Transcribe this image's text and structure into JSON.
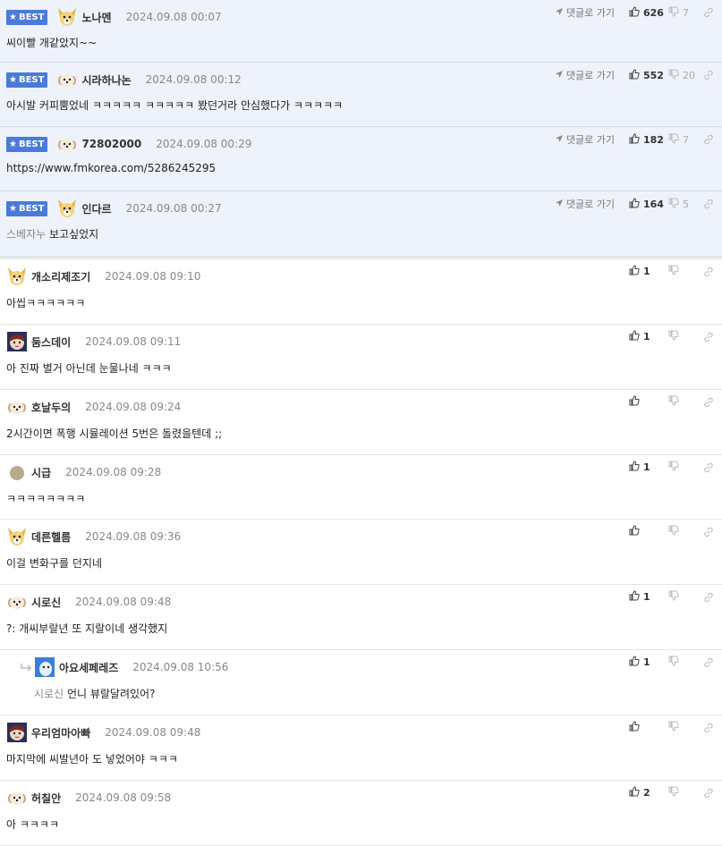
{
  "labels": {
    "best": "BEST",
    "goto": "댓글로 가기"
  },
  "colors": {
    "best_bg": "#eef2fb",
    "badge": "#4b7bd9"
  },
  "best_comments": [
    {
      "nick": "노나멘",
      "date": "2024.09.08 00:07",
      "text": "씨이빨 개같았지~~",
      "up": "626",
      "down": "7",
      "avatar": "dog-yellow-avatar"
    },
    {
      "nick": "시라하나논",
      "date": "2024.09.08 00:12",
      "text": "아시발 커피뿜었네 ㅋㅋㅋㅋㅋ ㅋㅋㅋㅋㅋ 봤던거라 안심했다가 ㅋㅋㅋㅋㅋ",
      "up": "552",
      "down": "20",
      "avatar": "puppy-white-avatar"
    },
    {
      "nick": "72802000",
      "date": "2024.09.08 00:29",
      "text": "https://www.fmkorea.com/5286245295",
      "up": "182",
      "down": "7",
      "avatar": "puppy-white-avatar"
    },
    {
      "nick": "인다르",
      "date": "2024.09.08 00:27",
      "reply_to": "스베자누",
      "text": "보고싶었지",
      "up": "164",
      "down": "5",
      "avatar": "dog-yellow-avatar"
    }
  ],
  "comments": [
    {
      "nick": "개소리제조기",
      "date": "2024.09.08 09:10",
      "text": "아씹ㅋㅋㅋㅋㅋㅋ",
      "up": "1",
      "avatar": "dog-yellow-avatar"
    },
    {
      "nick": "둠스데이",
      "date": "2024.09.08 09:11",
      "text": "아 진짜 별거 아닌데 눈물나네 ㅋㅋㅋ",
      "up": "1",
      "avatar": "face-avatar"
    },
    {
      "nick": "호날두의",
      "date": "2024.09.08 09:24",
      "text": "2시간이면 폭행 시뮬레이션 5번은 돌렸을텐데 ;;",
      "up": "",
      "avatar": "puppy-white-avatar"
    },
    {
      "nick": "시급",
      "date": "2024.09.08 09:28",
      "text": "ㅋㅋㅋㅋㅋㅋㅋㅋ",
      "up": "1",
      "avatar": "circle-avatar"
    },
    {
      "nick": "데른헬름",
      "date": "2024.09.08 09:36",
      "text": "이걸 변화구를 던지네",
      "up": "",
      "avatar": "dog-yellow-avatar"
    },
    {
      "nick": "시로신",
      "date": "2024.09.08 09:48",
      "text": "?: 개씨부랄년 또 지랄이네 생각했지",
      "up": "1",
      "avatar": "puppy-white-avatar"
    },
    {
      "nick": "아요세페레즈",
      "date": "2024.09.08 10:56",
      "reply_to": "시로신",
      "text": "언니 뷰랄달려있어?",
      "up": "1",
      "avatar": "blue-avatar",
      "is_reply": true
    },
    {
      "nick": "우리엄마아빠",
      "date": "2024.09.08 09:48",
      "text": "마지막에 씨발년아 도 넣었어야 ㅋㅋㅋ",
      "up": "",
      "avatar": "face-avatar"
    },
    {
      "nick": "허칠안",
      "date": "2024.09.08 09:58",
      "text": "아 ㅋㅋㅋㅋ",
      "up": "2",
      "avatar": "puppy-white-avatar"
    }
  ]
}
